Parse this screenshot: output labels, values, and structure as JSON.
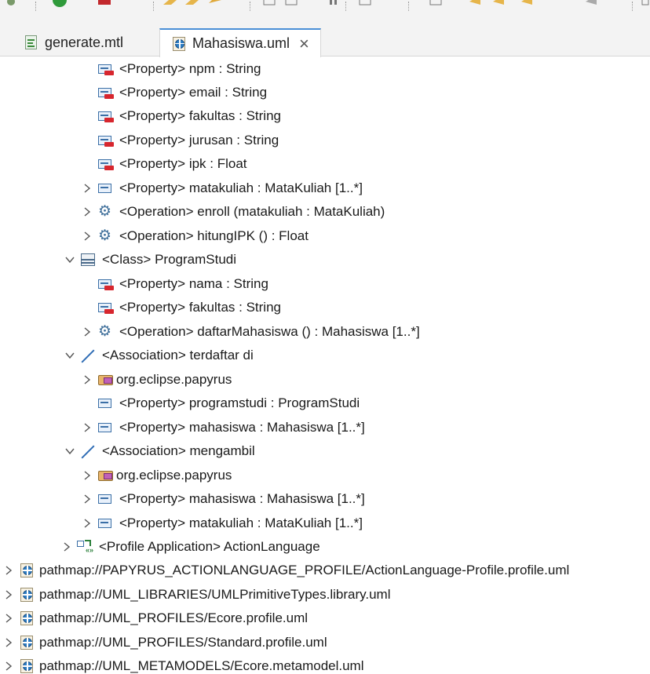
{
  "tabs": [
    {
      "label": "generate.mtl",
      "icon": "mtl-file-icon",
      "active": false
    },
    {
      "label": "Mahasiswa.uml",
      "icon": "uml-file-icon",
      "active": true,
      "close": "×"
    }
  ],
  "tree": [
    {
      "label": "<Property> npm : String",
      "icon": "property-icon",
      "twisty": ""
    },
    {
      "label": "<Property> email : String",
      "icon": "property-icon",
      "twisty": ""
    },
    {
      "label": "<Property> fakultas : String",
      "icon": "property-icon",
      "twisty": ""
    },
    {
      "label": "<Property> jurusan : String",
      "icon": "property-icon",
      "twisty": ""
    },
    {
      "label": "<Property> ipk : Float",
      "icon": "property-icon",
      "twisty": ""
    },
    {
      "label": "<Property> matakuliah : MataKuliah [1..*]",
      "icon": "property-icon",
      "twisty": ">"
    },
    {
      "label": "<Operation> enroll (matakuliah : MataKuliah)",
      "icon": "operation-gear-icon",
      "twisty": ">"
    },
    {
      "label": "<Operation> hitungIPK () : Float",
      "icon": "operation-gear-icon",
      "twisty": ">"
    },
    {
      "label": "<Class> ProgramStudi",
      "icon": "class-icon",
      "twisty": "v"
    },
    {
      "label": "<Property> nama : String",
      "icon": "property-icon",
      "twisty": ""
    },
    {
      "label": "<Property> fakultas : String",
      "icon": "property-icon",
      "twisty": ""
    },
    {
      "label": "<Operation> daftarMahasiswa () : Mahasiswa [1..*]",
      "icon": "operation-gear-icon",
      "twisty": ">"
    },
    {
      "label": "<Association> terdaftar di",
      "icon": "association-icon",
      "twisty": "v"
    },
    {
      "label": "org.eclipse.papyrus",
      "icon": "package-icon",
      "twisty": ">"
    },
    {
      "label": "<Property> programstudi : ProgramStudi",
      "icon": "property-icon",
      "twisty": ""
    },
    {
      "label": "<Property> mahasiswa : Mahasiswa [1..*]",
      "icon": "property-icon",
      "twisty": ">"
    },
    {
      "label": "<Association> mengambil",
      "icon": "association-icon",
      "twisty": "v"
    },
    {
      "label": "org.eclipse.papyrus",
      "icon": "package-icon",
      "twisty": ">"
    },
    {
      "label": "<Property> mahasiswa : Mahasiswa [1..*]",
      "icon": "property-icon",
      "twisty": ">"
    },
    {
      "label": "<Property> matakuliah : MataKuliah [1..*]",
      "icon": "property-icon",
      "twisty": ">"
    },
    {
      "label": "<Profile Application> ActionLanguage",
      "icon": "profile-application-icon",
      "twisty": ">"
    },
    {
      "label": "pathmap://PAPYRUS_ACTIONLANGUAGE_PROFILE/ActionLanguage-Profile.profile.uml",
      "icon": "uml-resource-icon",
      "twisty": ">"
    },
    {
      "label": "pathmap://UML_LIBRARIES/UMLPrimitiveTypes.library.uml",
      "icon": "uml-resource-icon",
      "twisty": ">"
    },
    {
      "label": "pathmap://UML_PROFILES/Ecore.profile.uml",
      "icon": "uml-resource-icon",
      "twisty": ">"
    },
    {
      "label": "pathmap://UML_PROFILES/Standard.profile.uml",
      "icon": "uml-resource-icon",
      "twisty": ">"
    },
    {
      "label": "pathmap://UML_METAMODELS/Ecore.metamodel.uml",
      "icon": "uml-resource-icon",
      "twisty": ">"
    }
  ]
}
